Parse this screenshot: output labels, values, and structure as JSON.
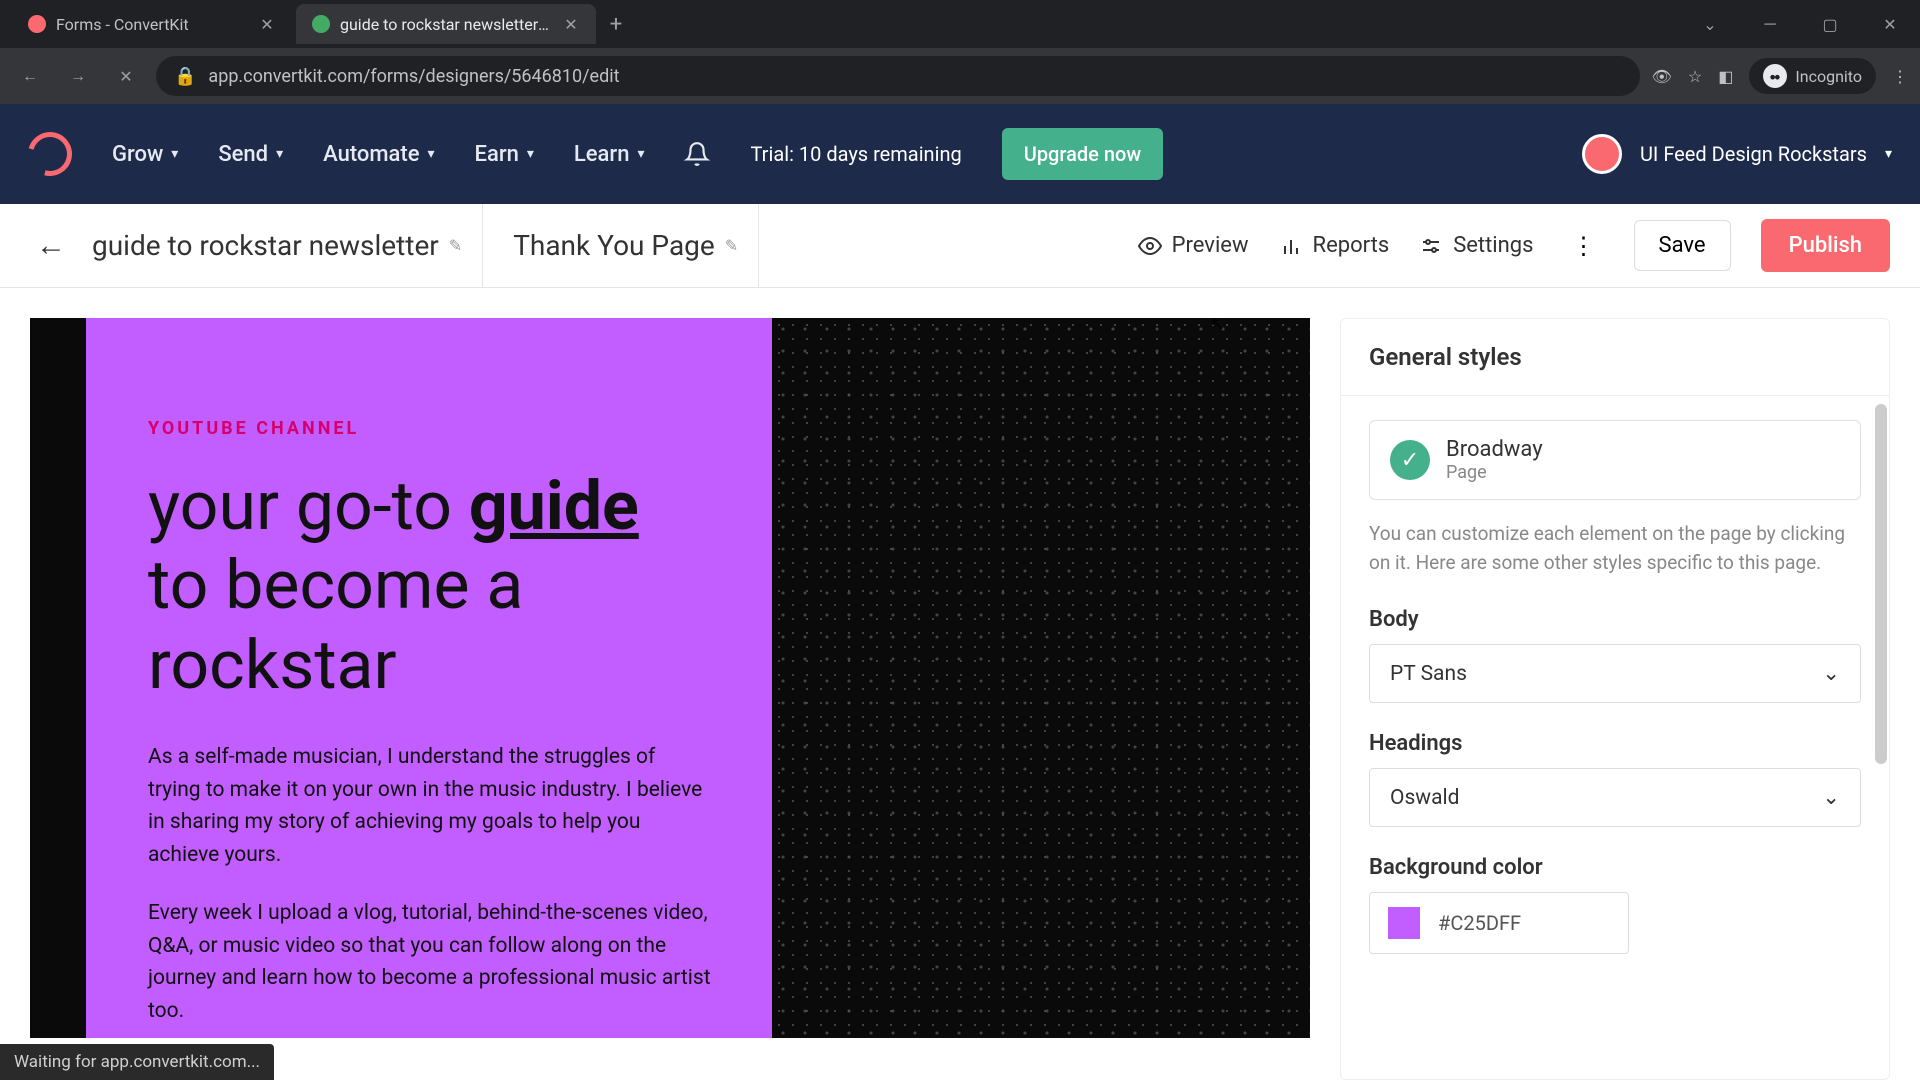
{
  "browser": {
    "tabs": [
      {
        "title": "Forms - ConvertKit",
        "active": false
      },
      {
        "title": "guide to rockstar newsletter - Co",
        "active": true
      }
    ],
    "url": "app.convertkit.com/forms/designers/5646810/edit",
    "incognito_label": "Incognito",
    "status_text": "Waiting for app.convertkit.com..."
  },
  "header": {
    "nav": [
      "Grow",
      "Send",
      "Automate",
      "Earn",
      "Learn"
    ],
    "trial": "Trial: 10 days remaining",
    "upgrade": "Upgrade now",
    "account": "UI Feed Design Rockstars"
  },
  "secbar": {
    "title": "guide to rockstar newsletter",
    "tab2": "Thank You Page",
    "actions": {
      "preview": "Preview",
      "reports": "Reports",
      "settings": "Settings"
    },
    "save": "Save",
    "publish": "Publish"
  },
  "canvas": {
    "eyebrow": "YOUTUBE CHANNEL",
    "title_pre": "your go-to ",
    "title_under": "guide",
    "title_post": " to become a rockstar",
    "p1": "As a self-made musician, I understand the struggles of trying to make it on your own in the music industry. I believe in sharing my story of achieving my goals to help you achieve yours.",
    "p2": "Every week I upload a vlog, tutorial, behind-the-scenes video, Q&A, or music video so that you can follow along on the journey and learn how to become a professional music artist too."
  },
  "sidebar": {
    "header": "General styles",
    "template": {
      "name": "Broadway",
      "type": "Page"
    },
    "help": "You can customize each element on the page by clicking on it. Here are some other styles specific to this page.",
    "body_label": "Body",
    "body_font": "PT Sans",
    "headings_label": "Headings",
    "headings_font": "Oswald",
    "bgcolor_label": "Background color",
    "bgcolor_value": "#C25DFF"
  }
}
